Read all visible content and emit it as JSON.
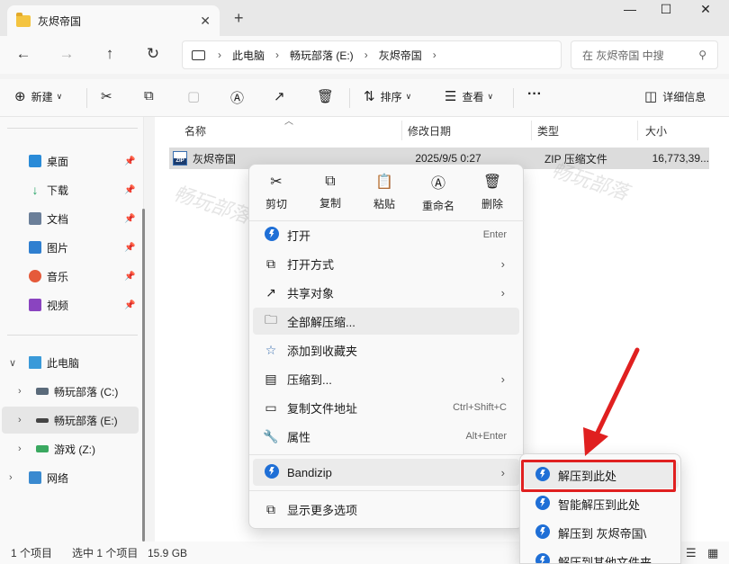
{
  "window": {
    "tab_title": "灰烬帝国",
    "tab_close": "✕",
    "new_tab": "+",
    "minimize": "—",
    "maximize": "☐",
    "close": "✕"
  },
  "address": {
    "crumbs": [
      "此电脑",
      "畅玩部落 (E:)",
      "灰烬帝国"
    ],
    "sep": "›",
    "search_placeholder": "在 灰烬帝国 中搜"
  },
  "toolbar": {
    "new_label": "新建",
    "sort_label": "排序",
    "view_label": "查看",
    "more_label": "···",
    "details_label": "详细信息"
  },
  "sidebar": {
    "quick": [
      {
        "label": "桌面",
        "color": "#2a8bd8"
      },
      {
        "label": "下载",
        "color": "#1ea060"
      },
      {
        "label": "文档",
        "color": "#6b7f99"
      },
      {
        "label": "图片",
        "color": "#2f7fd0"
      },
      {
        "label": "音乐",
        "color": "#e55a3a"
      },
      {
        "label": "视频",
        "color": "#8a44c0"
      }
    ],
    "this_pc": "此电脑",
    "drives": [
      {
        "label": "畅玩部落 (C:)"
      },
      {
        "label": "畅玩部落 (E:)"
      },
      {
        "label": "游戏 (Z:)"
      }
    ],
    "network": "网络"
  },
  "columns": {
    "name": "名称",
    "modified": "修改日期",
    "type": "类型",
    "size": "大小"
  },
  "file": {
    "name": "灰烬帝国",
    "modified": "2025/9/5 0:27",
    "type": "ZIP 压缩文件",
    "size": "16,773,39..."
  },
  "watermark": "畅玩部落",
  "context_menu": {
    "quick_actions": [
      {
        "label": "剪切",
        "icon": "✂"
      },
      {
        "label": "复制",
        "icon": "⧉"
      },
      {
        "label": "粘贴",
        "icon": "📋"
      },
      {
        "label": "重命名",
        "icon": "Ⓐ"
      },
      {
        "label": "删除",
        "icon": "🗑"
      }
    ],
    "items": {
      "open": "打开",
      "open_shortcut": "Enter",
      "open_with": "打开方式",
      "share": "共享对象",
      "extract_all": "全部解压缩...",
      "add_favorites": "添加到收藏夹",
      "compress_to": "压缩到...",
      "copy_path": "复制文件地址",
      "copy_path_shortcut": "Ctrl+Shift+C",
      "properties": "属性",
      "properties_shortcut": "Alt+Enter",
      "bandizip": "Bandizip",
      "more_options": "显示更多选项"
    }
  },
  "submenu": {
    "items": [
      "解压到此处",
      "智能解压到此处",
      "解压到 灰烬帝国\\",
      "解压到其他文件夹"
    ]
  },
  "status": {
    "count": "1 个项目",
    "selected": "选中 1 个项目",
    "size": "15.9 GB"
  },
  "colors": {
    "highlight_box": "#e02020",
    "bandizip_blue": "#1f6fd6"
  }
}
